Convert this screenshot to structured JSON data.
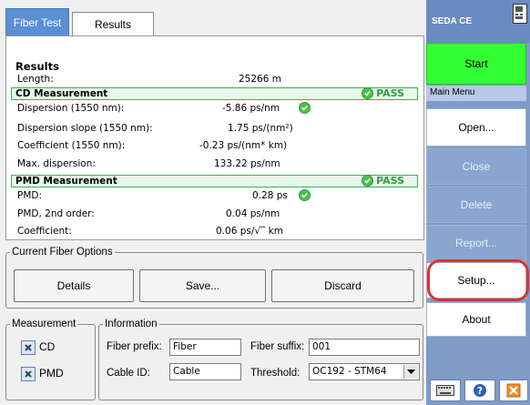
{
  "tabs": [
    {
      "label": "Fiber Test"
    },
    {
      "label": "Results"
    }
  ],
  "results": {
    "heading": "Results",
    "length_label": "Length:",
    "length_value": "25266 m",
    "cd": {
      "title": "CD Measurement",
      "status": "PASS",
      "rows": [
        {
          "label": "Dispersion (1550 nm):",
          "value": "-5.86 ps/nm"
        },
        {
          "label": "Dispersion slope (1550 nm):",
          "value": "1.75 ps/(nm²)"
        },
        {
          "label": "Coefficient (1550 nm):",
          "value": "-0.23 ps/(nm* km)"
        },
        {
          "label": "Max. dispersion:",
          "value": "133.22 ps/nm"
        }
      ]
    },
    "pmd": {
      "title": "PMD Measurement",
      "status": "PASS",
      "rows": [
        {
          "label": "PMD:",
          "value": "0.28 ps"
        },
        {
          "label": "PMD, 2nd order:",
          "value": "0.04 ps/nm"
        },
        {
          "label": "Coefficient:",
          "value": "0.06 ps/√‾ km"
        }
      ]
    }
  },
  "fiber_options": {
    "legend": "Current Fiber Options",
    "details": "Details",
    "save": "Save...",
    "discard": "Discard"
  },
  "measurement": {
    "legend": "Measurement",
    "cd": "CD",
    "pmd": "PMD"
  },
  "information": {
    "legend": "Information",
    "fiber_prefix_label": "Fiber prefix:",
    "fiber_prefix_value": "Fiber",
    "fiber_suffix_label": "Fiber suffix:",
    "fiber_suffix_value": "001",
    "cable_id_label": "Cable ID:",
    "cable_id_value": "Cable",
    "threshold_label": "Threshold:",
    "threshold_value": "OC192 - STM64"
  },
  "sidebar": {
    "title": "SEDA CE",
    "start": "Start",
    "menu_label": "Main Menu",
    "items": [
      {
        "label": "Open..."
      },
      {
        "label": "Close"
      },
      {
        "label": "Delete"
      },
      {
        "label": "Report..."
      },
      {
        "label": "Setup..."
      },
      {
        "label": "About"
      }
    ]
  },
  "colors": {
    "pass": "#2f9e44",
    "start": "#33ff33",
    "highlight": "#e03030",
    "sidebar": "#7f9cc8"
  }
}
